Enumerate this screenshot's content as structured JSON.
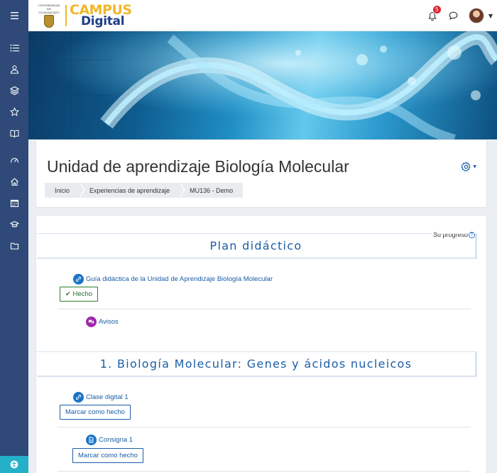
{
  "navbar": {
    "logo_university": "UNIVERSIDAD DE GUANAJUATO",
    "brand_top": "CAMPUS",
    "brand_bottom": "Digital",
    "notification_count": "5"
  },
  "sidebar": {
    "items": [
      "menu-list-icon",
      "participants-icon",
      "layers-icon",
      "star-icon",
      "book-icon",
      "dashboard-icon",
      "home-icon",
      "calendar-icon",
      "graduation-cap-icon",
      "folder-icon"
    ]
  },
  "header": {
    "title": "Unidad de aprendizaje Biología Molecular",
    "breadcrumb": [
      "Inicio",
      "Experiencias de aprendizaje",
      "MU136 - Demo"
    ]
  },
  "content": {
    "progress_label": "Su progreso",
    "sections": [
      {
        "title": "Plan didáctico",
        "activities": [
          {
            "label": "Guía didáctica de la Unidad de Aprendizaje Biología Molecular",
            "icon": "link-icon",
            "button": "Hecho"
          },
          {
            "label": "Avisos",
            "icon": "forum-icon"
          }
        ]
      },
      {
        "title": "1. Biología Molecular: Genes y ácidos nucleicos",
        "activities": [
          {
            "label": "Clase digital 1",
            "icon": "link-icon",
            "button": "Marcar como hecho"
          },
          {
            "label": "Consigna 1",
            "icon": "page-icon",
            "button": "Marcar como hecho"
          }
        ]
      }
    ]
  },
  "colors": {
    "sidebar": "#2f4a78",
    "accent": "#1a5ea8",
    "brand_gold": "#f1b72a",
    "brand_blue": "#1f3f8a",
    "badge": "#d9232e",
    "done": "#2e7d32"
  }
}
